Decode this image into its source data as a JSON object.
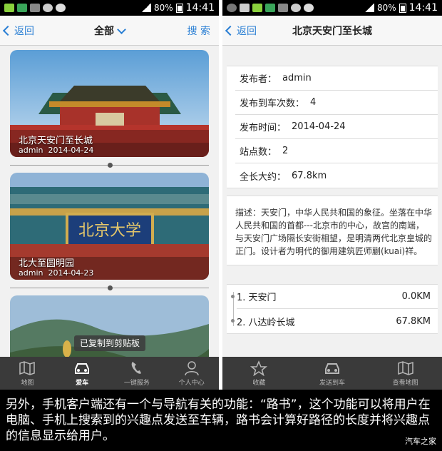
{
  "status_left": {
    "battery": "80%",
    "time": "14:41"
  },
  "status_right": {
    "battery": "80%",
    "time": "14:41"
  },
  "left_screen": {
    "back_label": "返回",
    "title": "全部",
    "search_label": "搜 索",
    "cards": [
      {
        "title": "北京天安门至长城",
        "author": "admin",
        "date": "2014-04-24"
      },
      {
        "title": "北大至圆明园",
        "author": "admin",
        "date": "2014-04-23"
      }
    ],
    "toast": "已复制到剪贴板",
    "tabs": [
      "地图",
      "爱车",
      "一键服务",
      "个人中心"
    ]
  },
  "right_screen": {
    "back_label": "返回",
    "title": "北京天安门至长城",
    "info": [
      {
        "label": "发布者：",
        "value": "admin"
      },
      {
        "label": "发布到车次数：",
        "value": "4"
      },
      {
        "label": "发布时间：",
        "value": "2014-04-24"
      },
      {
        "label": "站点数：",
        "value": "2"
      },
      {
        "label": "全长大约：",
        "value": "67.8km"
      }
    ],
    "description": "描述：天安门，中华人民共和国的象征。坐落在中华人民共和国的首都---北京市的中心，故宫的南端，与天安门广场隔长安街相望，是明清两代北京皇城的正门。设计者为明代的御用建筑匠师蒯(kuai)祥。",
    "stops": [
      {
        "name": "1. 天安门",
        "dist": "0.0KM"
      },
      {
        "name": "2. 八达岭长城",
        "dist": "67.8KM"
      }
    ],
    "tabs": [
      "收藏",
      "发送到车",
      "查看地图"
    ]
  },
  "caption": "另外，手机客户端还有一个与导航有关的功能：“路书”，这个功能可以将用户在电脑、手机上搜索到的兴趣点发送至车辆，路书会计算好路径的长度并将兴趣点的信息显示给用户。",
  "watermark": "汽车之家"
}
